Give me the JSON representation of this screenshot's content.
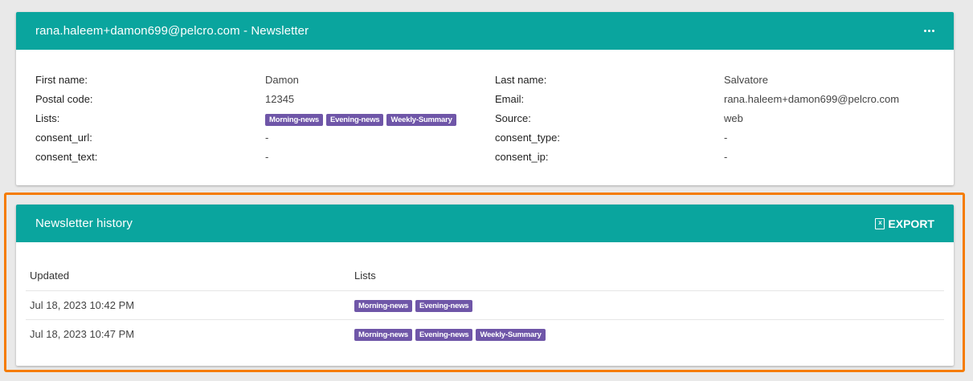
{
  "details_card": {
    "title": "rana.haleem+damon699@pelcro.com - Newsletter",
    "fields": {
      "first_name_label": "First name:",
      "first_name": "Damon",
      "last_name_label": "Last name:",
      "last_name": "Salvatore",
      "postal_code_label": "Postal code:",
      "postal_code": "12345",
      "email_label": "Email:",
      "email": "rana.haleem+damon699@pelcro.com",
      "lists_label": "Lists:",
      "lists": [
        "Morning-news",
        "Evening-news",
        "Weekly-Summary"
      ],
      "source_label": "Source:",
      "source": "web",
      "consent_url_label": "consent_url:",
      "consent_url": "-",
      "consent_type_label": "consent_type:",
      "consent_type": "-",
      "consent_text_label": "consent_text:",
      "consent_text": "-",
      "consent_ip_label": "consent_ip:",
      "consent_ip": "-"
    }
  },
  "history_card": {
    "title": "Newsletter history",
    "export_label": "EXPORT",
    "columns": [
      "Updated",
      "Lists"
    ],
    "rows": [
      {
        "updated": "Jul 18, 2023 10:42 PM",
        "lists": [
          "Morning-news",
          "Evening-news"
        ]
      },
      {
        "updated": "Jul 18, 2023 10:47 PM",
        "lists": [
          "Morning-news",
          "Evening-news",
          "Weekly-Summary"
        ]
      }
    ]
  },
  "colors": {
    "header": "#0aa59e",
    "tag": "#6f56a8",
    "highlight": "#f57c00"
  },
  "icons": {
    "more": "more-horizontal-icon",
    "export": "excel-file-icon"
  }
}
